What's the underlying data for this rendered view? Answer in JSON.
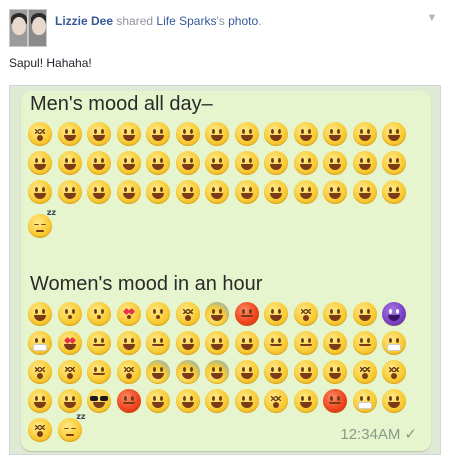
{
  "post": {
    "author": "Lizzie Dee",
    "verb": "shared",
    "page_name": "Life Sparks",
    "possessive_suffix": "'s",
    "object": "photo",
    "period": ".",
    "caption": "Sapul! Hahaha!"
  },
  "photo": {
    "men_title": "Men's mood all day–",
    "women_title": "Women's mood in an hour",
    "timestamp": "12:34AM",
    "check_glyph": "✓"
  },
  "colors": {
    "link": "#365899",
    "muted": "#90949c",
    "bubble": "#e6f5cd"
  }
}
